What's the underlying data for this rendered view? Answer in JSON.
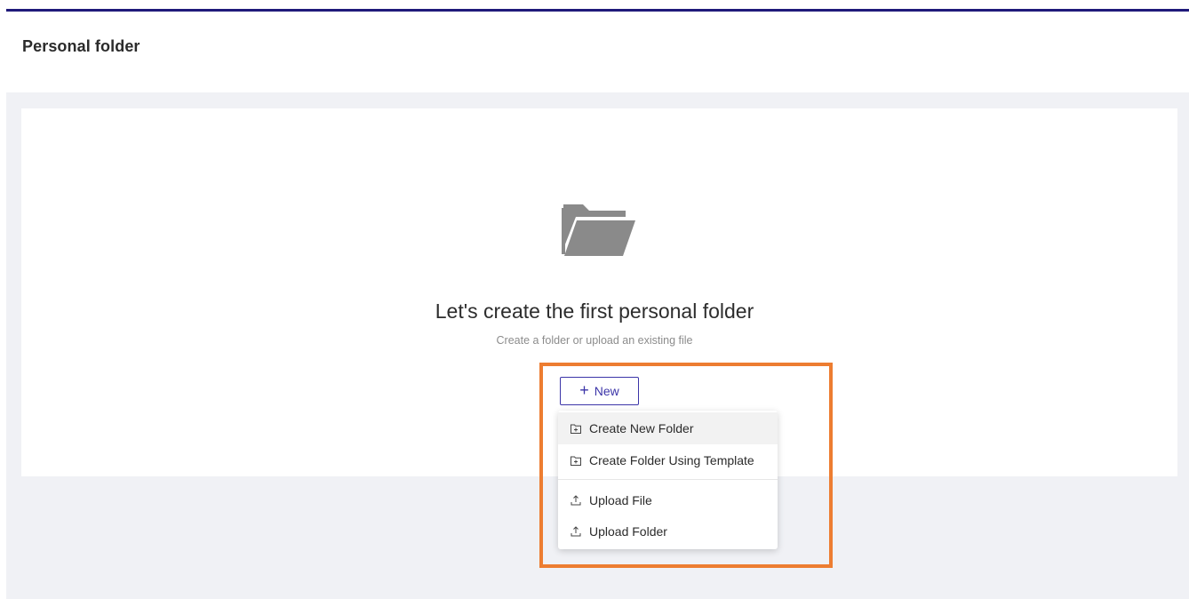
{
  "header": {
    "title": "Personal folder"
  },
  "empty_state": {
    "icon": "folder-open-icon",
    "heading": "Let's create the first personal folder",
    "subtext": "Create a folder or upload an existing file"
  },
  "new_button": {
    "label": "New",
    "icon": "plus-icon"
  },
  "new_menu": {
    "items": [
      {
        "label": "Create New Folder",
        "icon": "folder-plus-icon"
      },
      {
        "label": "Create Folder Using Template",
        "icon": "folder-plus-icon"
      },
      {
        "label": "Upload File",
        "icon": "upload-icon"
      },
      {
        "label": "Upload Folder",
        "icon": "upload-icon"
      }
    ]
  },
  "colors": {
    "accent": "#3b34a8",
    "top_bar": "#1f1a7a",
    "highlight": "#ed7d31",
    "background": "#f0f1f5"
  }
}
